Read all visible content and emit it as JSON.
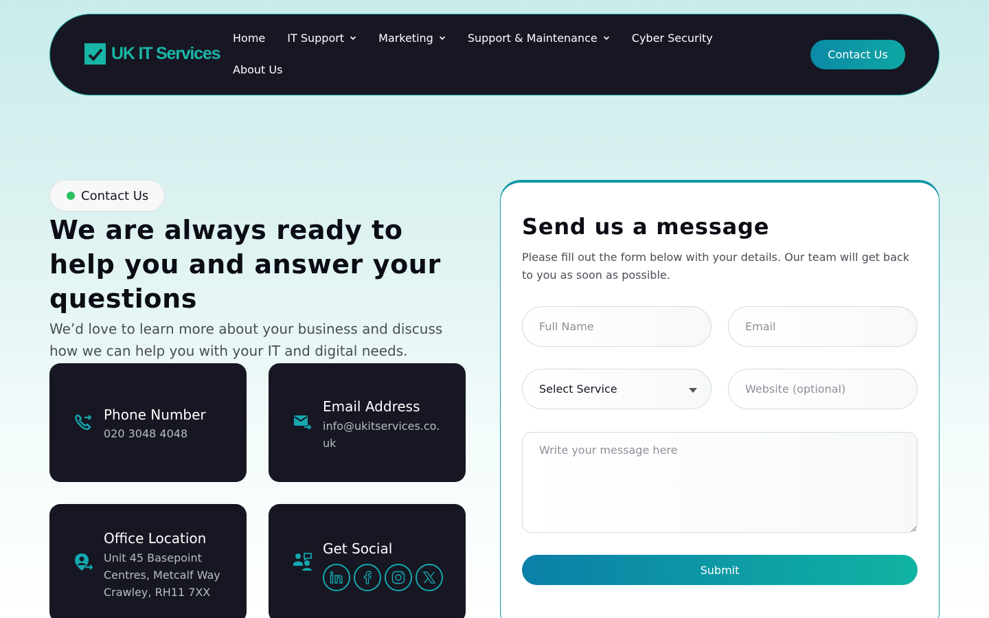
{
  "header": {
    "logo_text": "UK IT Services",
    "nav": [
      {
        "label": "Home",
        "has_dropdown": false
      },
      {
        "label": "IT Support",
        "has_dropdown": true
      },
      {
        "label": "Marketing",
        "has_dropdown": true
      },
      {
        "label": "Support & Maintenance",
        "has_dropdown": true
      },
      {
        "label": "Cyber Security",
        "has_dropdown": false
      },
      {
        "label": "About Us",
        "has_dropdown": false
      }
    ],
    "cta_label": "Contact Us"
  },
  "hero": {
    "badge": "Contact Us",
    "title": "We are always ready to help you and answer your questions",
    "subtitle": "We’d love to learn more about your business and discuss how we can help you with your IT and digital needs."
  },
  "contact_cards": {
    "phone": {
      "title": "Phone Number",
      "value": "020 3048 4048",
      "icon": "phone-icon"
    },
    "email": {
      "title": "Email Address",
      "value": "info@ukitservices.co.uk",
      "icon": "mail-icon"
    },
    "office": {
      "title": "Office Location",
      "value": "Unit 45 Basepoint Centres, Metcalf Way Crawley, RH11 7XX",
      "icon": "location-user-icon"
    },
    "social": {
      "title": "Get Social",
      "icon": "people-icon",
      "networks": [
        "linkedin",
        "facebook",
        "instagram",
        "x"
      ]
    }
  },
  "form": {
    "title": "Send us a message",
    "description": "Please fill out the form below with your details. Our team will get back to you as soon as possible.",
    "full_name_placeholder": "Full Name",
    "email_placeholder": "Email",
    "service_selected": "Select Service",
    "website_placeholder": "Website (optional)",
    "message_placeholder": "Write your message here",
    "submit_label": "Submit"
  },
  "colors": {
    "accent": "#0fa7a3",
    "dark": "#161722",
    "status_dot": "#2cc060"
  }
}
